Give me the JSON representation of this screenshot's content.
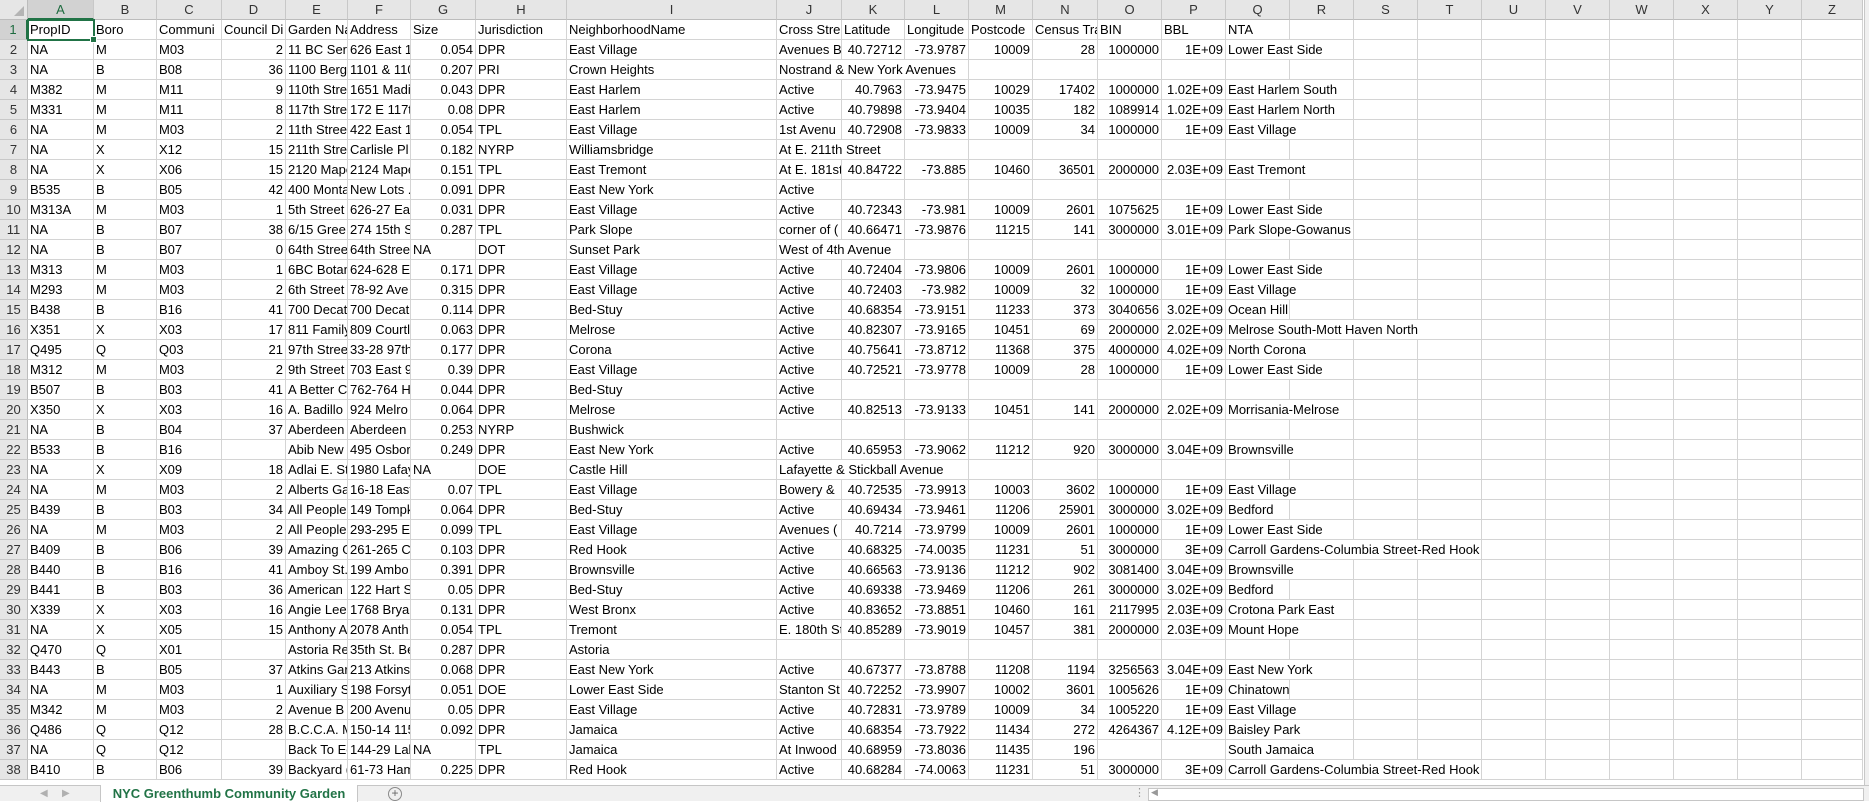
{
  "app": {
    "accent_color": "#217346"
  },
  "selected_cell": "A1",
  "columns": [
    "A",
    "B",
    "C",
    "D",
    "E",
    "F",
    "G",
    "H",
    "I",
    "J",
    "K",
    "L",
    "M",
    "N",
    "O",
    "P",
    "Q",
    "R",
    "S",
    "T",
    "U",
    "V",
    "W",
    "X",
    "Y",
    "Z"
  ],
  "sheet": {
    "rows": [
      [
        "PropID",
        "Boro",
        "Communi",
        "Council Di",
        "Garden Na",
        "Address",
        "Size",
        "Jurisdiction",
        "NeighborhoodName",
        "Cross Stre",
        "Latitude",
        "Longitude",
        "Postcode",
        "Census Tra",
        "BIN",
        "BBL",
        "NTA"
      ],
      [
        "NA",
        "M",
        "M03",
        "2",
        "11 BC Sere",
        "626 East 1:",
        "0.054",
        "DPR",
        "East Village",
        "Avenues B",
        "40.72712",
        "-73.9787",
        "10009",
        "28",
        "1000000",
        "1E+09",
        "Lower East Side"
      ],
      [
        "NA",
        "B",
        "B08",
        "36",
        "1100 Berge",
        "1101 & 110",
        "0.207",
        "PRI",
        "Crown Heights",
        "Nostrand & New York Avenues"
      ],
      [
        "M382",
        "M",
        "M11",
        "9",
        "110th Stre",
        "1651 Madi",
        "0.043",
        "DPR",
        "East Harlem",
        "Active",
        "40.7963",
        "-73.9475",
        "10029",
        "17402",
        "1000000",
        "1.02E+09",
        "East Harlem South"
      ],
      [
        "M331",
        "M",
        "M11",
        "8",
        "117th Stre",
        "172 E 117t",
        "0.08",
        "DPR",
        "East Harlem",
        "Active",
        "40.79898",
        "-73.9404",
        "10035",
        "182",
        "1089914",
        "1.02E+09",
        "East Harlem North"
      ],
      [
        "NA",
        "M",
        "M03",
        "2",
        "11th Stree",
        "422 East 1:",
        "0.054",
        "TPL",
        "East Village",
        "1st Avenu",
        "40.72908",
        "-73.9833",
        "10009",
        "34",
        "1000000",
        "1E+09",
        "East Village"
      ],
      [
        "NA",
        "X",
        "X12",
        "15",
        "211th Stre",
        "Carlisle Pl",
        "0.182",
        "NYRP",
        "Williamsbridge",
        "At E. 211th Street"
      ],
      [
        "NA",
        "X",
        "X06",
        "15",
        "2120 Mape",
        "2124 Mape",
        "0.151",
        "TPL",
        "East Tremont",
        "At E. 181st",
        "40.84722",
        "-73.885",
        "10460",
        "36501",
        "2000000",
        "2.03E+09",
        "East Tremont"
      ],
      [
        "B535",
        "B",
        "B05",
        "42",
        "400 Monta",
        "New Lots .",
        "0.091",
        "DPR",
        "East New York",
        "Active"
      ],
      [
        "M313A",
        "M",
        "M03",
        "1",
        "5th Street",
        "626-27 Eas",
        "0.031",
        "DPR",
        "East Village",
        "Active",
        "40.72343",
        "-73.981",
        "10009",
        "2601",
        "1075625",
        "1E+09",
        "Lower East Side"
      ],
      [
        "NA",
        "B",
        "B07",
        "38",
        "6/15 Gree",
        "274 15th S",
        "0.287",
        "TPL",
        "Park Slope",
        "corner of (",
        "40.66471",
        "-73.9876",
        "11215",
        "141",
        "3000000",
        "3.01E+09",
        "Park Slope-Gowanus"
      ],
      [
        "NA",
        "B",
        "B07",
        "0",
        "64th Stree",
        "64th Stree",
        "NA",
        "DOT",
        "Sunset Park",
        "West of 4th Avenue"
      ],
      [
        "M313",
        "M",
        "M03",
        "1",
        "6BC Botan",
        "624-628 E (",
        "0.171",
        "DPR",
        "East Village",
        "Active",
        "40.72404",
        "-73.9806",
        "10009",
        "2601",
        "1000000",
        "1E+09",
        "Lower East Side"
      ],
      [
        "M293",
        "M",
        "M03",
        "2",
        "6th Street",
        "78-92 Ave",
        "0.315",
        "DPR",
        "East Village",
        "Active",
        "40.72403",
        "-73.982",
        "10009",
        "32",
        "1000000",
        "1E+09",
        "East Village"
      ],
      [
        "B438",
        "B",
        "B16",
        "41",
        "700 Decatu",
        "700 Decatu",
        "0.114",
        "DPR",
        "Bed-Stuy",
        "Active",
        "40.68354",
        "-73.9151",
        "11233",
        "373",
        "3040656",
        "3.02E+09",
        "Ocean Hill"
      ],
      [
        "X351",
        "X",
        "X03",
        "17",
        "811 Family",
        "809 Courtl",
        "0.063",
        "DPR",
        "Melrose",
        "Active",
        "40.82307",
        "-73.9165",
        "10451",
        "69",
        "2000000",
        "2.02E+09",
        "Melrose South-Mott Haven North"
      ],
      [
        "Q495",
        "Q",
        "Q03",
        "21",
        "97th Stree",
        "33-28 97th",
        "0.177",
        "DPR",
        "Corona",
        "Active",
        "40.75641",
        "-73.8712",
        "11368",
        "375",
        "4000000",
        "4.02E+09",
        "North Corona"
      ],
      [
        "M312",
        "M",
        "M03",
        "2",
        "9th Street",
        "703 East 9t",
        "0.39",
        "DPR",
        "East Village",
        "Active",
        "40.72521",
        "-73.9778",
        "10009",
        "28",
        "1000000",
        "1E+09",
        "Lower East Side"
      ],
      [
        "B507",
        "B",
        "B03",
        "41",
        "A Better C",
        "762-764 He",
        "0.044",
        "DPR",
        "Bed-Stuy",
        "Active"
      ],
      [
        "X350",
        "X",
        "X03",
        "16",
        "A. Badillo",
        "924 Melro",
        "0.064",
        "DPR",
        "Melrose",
        "Active",
        "40.82513",
        "-73.9133",
        "10451",
        "141",
        "2000000",
        "2.02E+09",
        "Morrisania-Melrose"
      ],
      [
        "NA",
        "B",
        "B04",
        "37",
        "Aberdeen",
        "Aberdeen",
        "0.253",
        "NYRP",
        "Bushwick"
      ],
      [
        "B533",
        "B",
        "B16",
        "",
        "Abib New",
        "495 Osbor",
        "0.249",
        "DPR",
        "East New York",
        "Active",
        "40.65953",
        "-73.9062",
        "11212",
        "920",
        "3000000",
        "3.04E+09",
        "Brownsville"
      ],
      [
        "NA",
        "X",
        "X09",
        "18",
        "Adlai E. St",
        "1980 Lafay",
        "NA",
        "DOE",
        "Castle Hill",
        "Lafayette & Stickball Avenue"
      ],
      [
        "NA",
        "M",
        "M03",
        "2",
        "Alberts Ga",
        "16-18 East",
        "0.07",
        "TPL",
        "East Village",
        "Bowery &",
        "40.72535",
        "-73.9913",
        "10003",
        "3602",
        "1000000",
        "1E+09",
        "East Village"
      ],
      [
        "B439",
        "B",
        "B03",
        "34",
        "All People",
        "149 Tompk",
        "0.064",
        "DPR",
        "Bed-Stuy",
        "Active",
        "40.69434",
        "-73.9461",
        "11206",
        "25901",
        "3000000",
        "3.02E+09",
        "Bedford"
      ],
      [
        "NA",
        "M",
        "M03",
        "2",
        "All People",
        "293-295 Ea",
        "0.099",
        "TPL",
        "East Village",
        "Avenues (",
        "40.7214",
        "-73.9799",
        "10009",
        "2601",
        "1000000",
        "1E+09",
        "Lower East Side"
      ],
      [
        "B409",
        "B",
        "B06",
        "39",
        "Amazing G",
        "261-265 Co",
        "0.103",
        "DPR",
        "Red Hook",
        "Active",
        "40.68325",
        "-74.0035",
        "11231",
        "51",
        "3000000",
        "3E+09",
        "Carroll Gardens-Columbia Street-Red Hook"
      ],
      [
        "B440",
        "B",
        "B16",
        "41",
        "Amboy St.",
        "199 Ambo",
        "0.391",
        "DPR",
        "Brownsville",
        "Active",
        "40.66563",
        "-73.9136",
        "11212",
        "902",
        "3081400",
        "3.04E+09",
        "Brownsville"
      ],
      [
        "B441",
        "B",
        "B03",
        "36",
        "American",
        "122 Hart St",
        "0.05",
        "DPR",
        "Bed-Stuy",
        "Active",
        "40.69338",
        "-73.9469",
        "11206",
        "261",
        "3000000",
        "3.02E+09",
        "Bedford"
      ],
      [
        "X339",
        "X",
        "X03",
        "16",
        "Angie Lee",
        "1768 Bryan",
        "0.131",
        "DPR",
        "West Bronx",
        "Active",
        "40.83652",
        "-73.8851",
        "10460",
        "161",
        "2117995",
        "2.03E+09",
        "Crotona Park East"
      ],
      [
        "NA",
        "X",
        "X05",
        "15",
        "Anthony A",
        "2078 Anth",
        "0.054",
        "TPL",
        "Tremont",
        "E. 180th St",
        "40.85289",
        "-73.9019",
        "10457",
        "381",
        "2000000",
        "2.03E+09",
        "Mount Hope"
      ],
      [
        "Q470",
        "Q",
        "X01",
        "",
        "Astoria Re",
        "35th St. Be",
        "0.287",
        "DPR",
        "Astoria"
      ],
      [
        "B443",
        "B",
        "B05",
        "37",
        "Atkins Gar",
        "213 Atkins",
        "0.068",
        "DPR",
        "East New York",
        "Active",
        "40.67377",
        "-73.8788",
        "11208",
        "1194",
        "3256563",
        "3.04E+09",
        "East New York"
      ],
      [
        "NA",
        "M",
        "M03",
        "1",
        "Auxiliary S",
        "198 Forsyt",
        "0.051",
        "DOE",
        "Lower East Side",
        "Stanton St",
        "40.72252",
        "-73.9907",
        "10002",
        "3601",
        "1005626",
        "1E+09",
        "Chinatown"
      ],
      [
        "M342",
        "M",
        "M03",
        "2",
        "Avenue B",
        "200 Avenu",
        "0.05",
        "DPR",
        "East Village",
        "Active",
        "40.72831",
        "-73.9789",
        "10009",
        "34",
        "1005220",
        "1E+09",
        "East Village"
      ],
      [
        "Q486",
        "Q",
        "Q12",
        "28",
        "B.C.C.A. M",
        "150-14 115",
        "0.092",
        "DPR",
        "Jamaica",
        "Active",
        "40.68354",
        "-73.7922",
        "11434",
        "272",
        "4264367",
        "4.12E+09",
        "Baisley Park"
      ],
      [
        "NA",
        "Q",
        "Q12",
        "",
        "Back To Ec",
        "144-29 Lak",
        "NA",
        "TPL",
        "Jamaica",
        "At Inwood",
        "40.68959",
        "-73.8036",
        "11435",
        "196",
        "",
        "",
        "South Jamaica"
      ],
      [
        "B410",
        "B",
        "B06",
        "39",
        "Backyard (",
        "61-73 Ham",
        "0.225",
        "DPR",
        "Red Hook",
        "Active",
        "40.68284",
        "-74.0063",
        "11231",
        "51",
        "3000000",
        "3E+09",
        "Carroll Gardens-Columbia Street-Red Hook"
      ]
    ]
  },
  "tabs": {
    "active": "NYC Greenthumb Community Garden",
    "add_icon": "plus-circle-icon"
  }
}
